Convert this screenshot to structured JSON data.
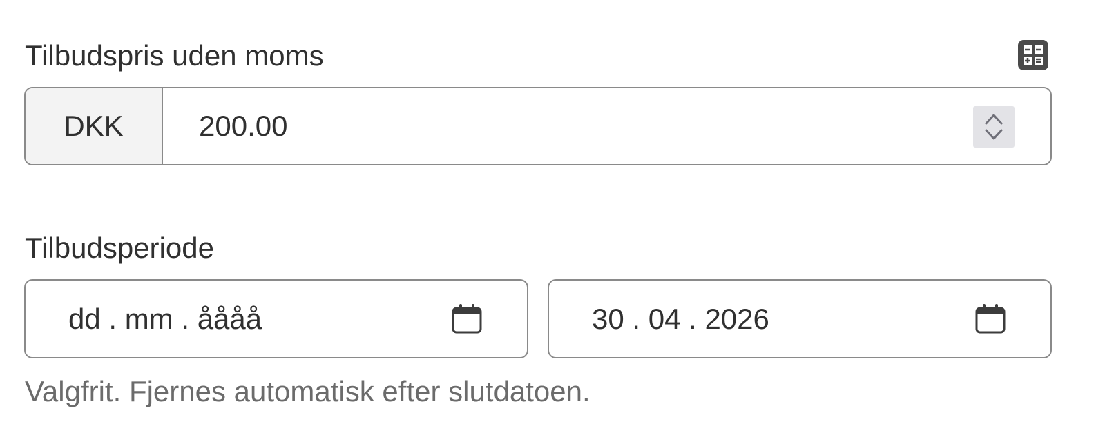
{
  "price_section": {
    "label": "Tilbudspris uden moms",
    "calculator_icon": "calculator-icon",
    "currency": "DKK",
    "value": "200.00",
    "stepper_icon": "up-down-chevron-icon"
  },
  "period_section": {
    "label": "Tilbudsperiode",
    "start_date_placeholder": "dd . mm . åååå",
    "end_date_value": "30 . 04 . 2026",
    "calendar_icon": "calendar-icon",
    "help_text": "Valgfrit. Fjernes automatisk efter slutdatoen."
  },
  "colors": {
    "text": "#303030",
    "muted_text": "#6b6b6b",
    "border": "#8a8a8a",
    "currency_background": "#f3f3f3",
    "stepper_background": "#e3e3e7",
    "calculator_background": "#4a4a4a"
  }
}
